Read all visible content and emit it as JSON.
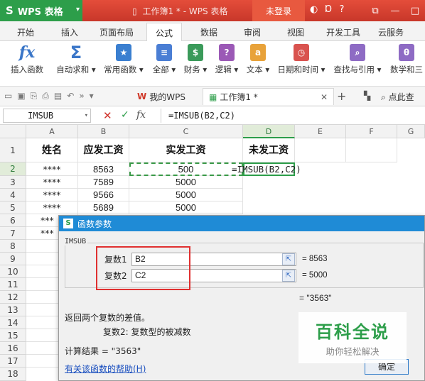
{
  "titlebar": {
    "app_name": "WPS 表格",
    "document_title": "工作簿1 * - WPS 表格",
    "login_label": "未登录"
  },
  "ribbon_tabs": [
    "开始",
    "插入",
    "页面布局",
    "公式",
    "数据",
    "审阅",
    "视图",
    "开发工具",
    "云服务"
  ],
  "active_tab": "公式",
  "ribbon": {
    "items": [
      {
        "label": "插入函数",
        "icon": "fx-icon"
      },
      {
        "label": "自动求和 ▾",
        "icon": "sigma-icon"
      },
      {
        "label": "常用函数 ▾",
        "icon": "star-icon"
      },
      {
        "label": "全部 ▾",
        "icon": "list-icon"
      },
      {
        "label": "财务 ▾",
        "icon": "finance-icon"
      },
      {
        "label": "逻辑 ▾",
        "icon": "logic-icon"
      },
      {
        "label": "文本 ▾",
        "icon": "text-icon"
      },
      {
        "label": "日期和时间 ▾",
        "icon": "clock-icon"
      },
      {
        "label": "查找与引用 ▾",
        "icon": "lookup-icon"
      },
      {
        "label": "数学和三",
        "icon": "math-icon"
      }
    ],
    "icon_glyphs": [
      "fx",
      "Σ",
      "★",
      "≡",
      "$",
      "?",
      "a",
      "◷",
      "⌕",
      "θ"
    ]
  },
  "doc_tabs": {
    "my_wps": "我的WPS",
    "workbook": "工作簿1 *",
    "search_hint": "点此查"
  },
  "formula_bar": {
    "name_box": "IMSUB",
    "formula": "=IMSUB(B2,C2)"
  },
  "sheet": {
    "columns": [
      "A",
      "B",
      "C",
      "D",
      "E",
      "F",
      "G"
    ],
    "rows": [
      "1",
      "2",
      "3",
      "4",
      "5",
      "6",
      "7",
      "8",
      "9",
      "10",
      "11",
      "12",
      "13",
      "14",
      "15",
      "16",
      "17",
      "18"
    ],
    "header_row": [
      "姓名",
      "应发工资",
      "实发工资",
      "未发工资"
    ],
    "data": [
      {
        "name": "****",
        "due": "8563",
        "paid": "500"
      },
      {
        "name": "****",
        "due": "7589",
        "paid": "5000"
      },
      {
        "name": "****",
        "due": "9566",
        "paid": "5000"
      },
      {
        "name": "****",
        "due": "5689",
        "paid": "5000"
      },
      {
        "name": "***",
        "due": "",
        "paid": ""
      },
      {
        "name": "***",
        "due": "",
        "paid": ""
      }
    ],
    "editing_formula": "=IMSUB(B2,C2)"
  },
  "dialog": {
    "title": "函数参数",
    "function_name": "IMSUB",
    "arg1_label": "复数1",
    "arg1_value": "B2",
    "arg1_result": "= 8563",
    "arg2_label": "复数2",
    "arg2_value": "C2",
    "arg2_result": "= 5000",
    "result_line": "= \"3563\"",
    "description": "返回两个复数的差值。",
    "param_desc": "复数2:   复数型的被减数",
    "calc_result": "计算结果 = \"3563\"",
    "help_link": "有关该函数的帮助(H)",
    "ok_label": "确定"
  },
  "watermark": {
    "title": "百科全说",
    "subtitle": "助你轻松解决"
  },
  "colors": {
    "title_red": "#d0392a",
    "wps_green": "#2d9e4a",
    "dialog_blue": "#1f8bd6",
    "highlight_red": "#e03030"
  }
}
